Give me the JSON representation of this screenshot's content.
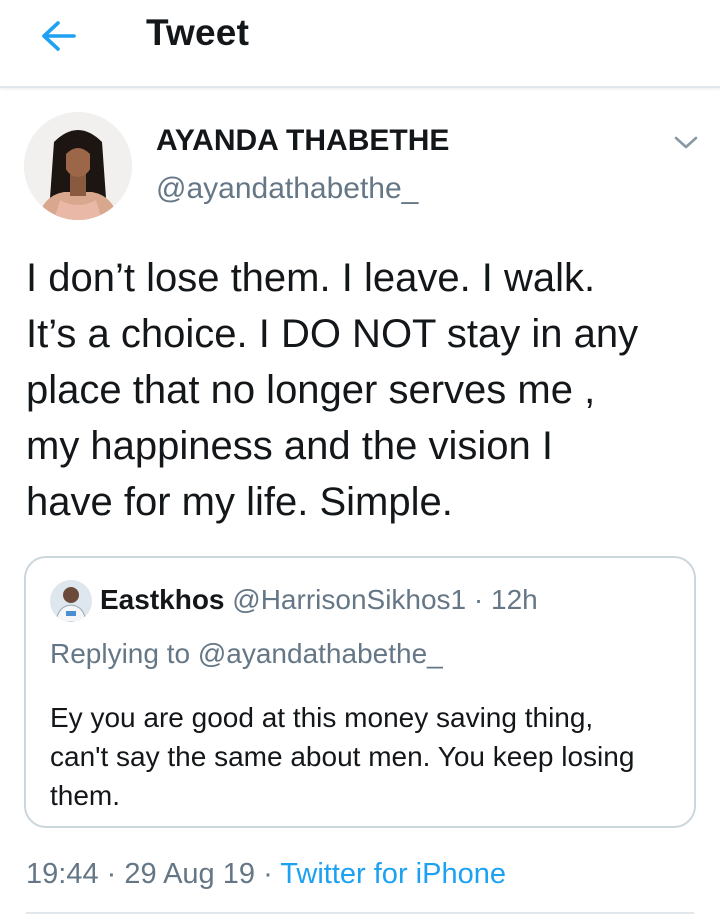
{
  "header": {
    "title": "Tweet",
    "back_icon": "arrow-left-icon",
    "accent_color": "#1da1f2"
  },
  "tweet": {
    "author_name": "AYANDA THABETHE",
    "author_handle": "@ayandathabethe_",
    "text": "I don’t lose them. I leave. I walk.\nIt’s a choice. I DO NOT stay in any\nplace that no longer serves me ,\nmy happiness and the vision I\nhave for my life. Simple."
  },
  "quoted_tweet": {
    "author_name": "Eastkhos",
    "author_handle": "@HarrisonSikhos1",
    "separator": "·",
    "time": "12h",
    "replying_to": "Replying to @ayandathabethe_",
    "text": "Ey you are good at this money saving thing,\ncan't say the same about men. You keep losing\nthem."
  },
  "meta": {
    "time": "19:44",
    "separator": "·",
    "date": "29 Aug 19",
    "source": "Twitter for iPhone"
  },
  "colors": {
    "text_primary": "#14171a",
    "text_secondary": "#657786",
    "link": "#1da1f2",
    "border": "#ccd6dd"
  }
}
